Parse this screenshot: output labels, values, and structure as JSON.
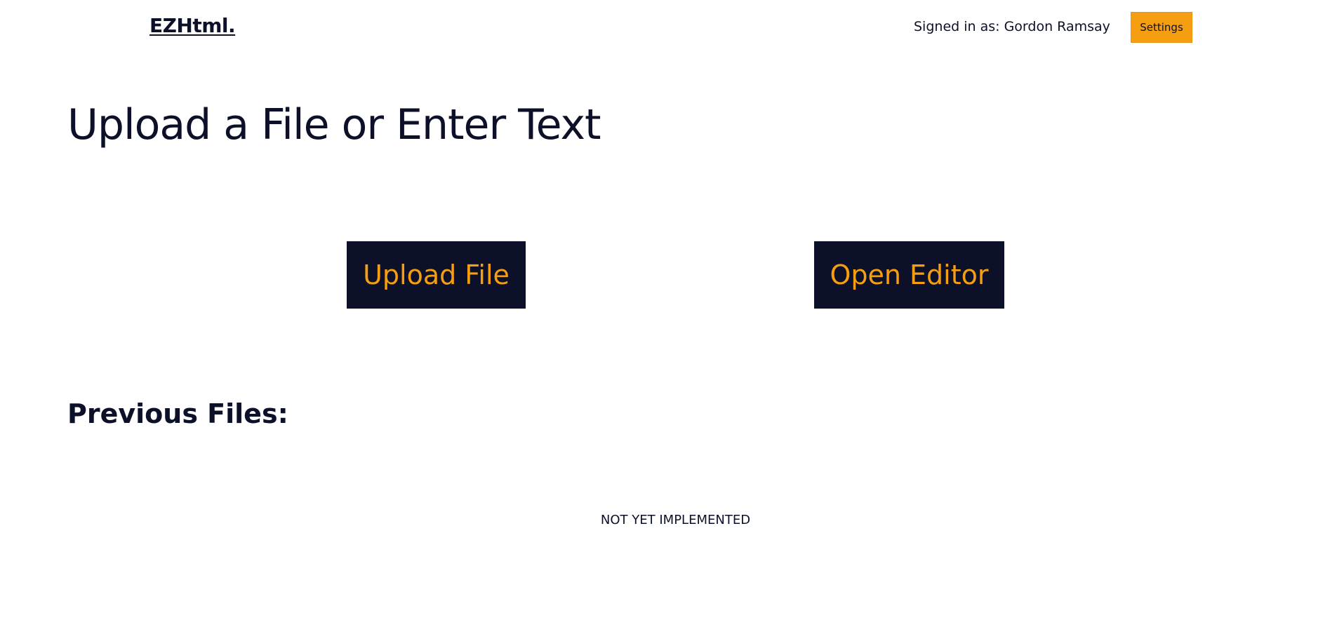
{
  "header": {
    "logo": "EZHtml.",
    "signed_in_text": "Signed in as: Gordon Ramsay",
    "settings_label": "Settings"
  },
  "main": {
    "title": "Upload a File or Enter Text",
    "upload_label": "Upload File",
    "editor_label": "Open Editor",
    "previous_files_heading": "Previous Files:",
    "previous_files_status": "NOT YET IMPLEMENTED"
  },
  "colors": {
    "navy": "#0c1129",
    "accent_orange": "#f59e12",
    "background": "#ffffff"
  }
}
